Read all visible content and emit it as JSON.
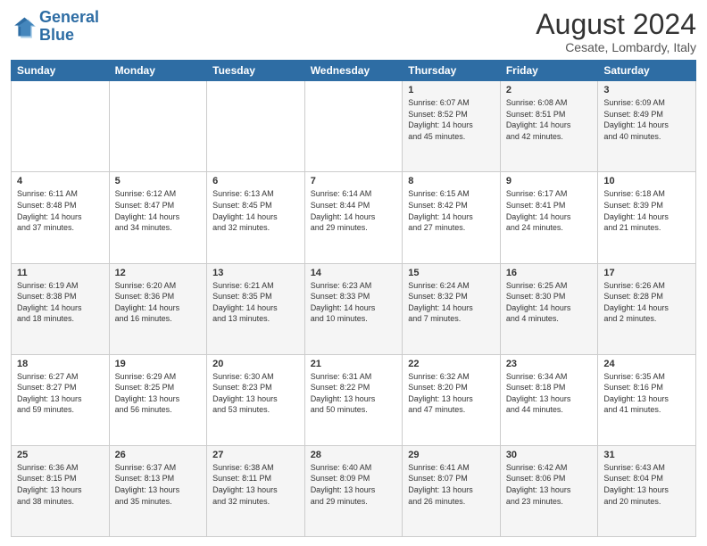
{
  "header": {
    "logo_line1": "General",
    "logo_line2": "Blue",
    "month_year": "August 2024",
    "location": "Cesate, Lombardy, Italy"
  },
  "days_of_week": [
    "Sunday",
    "Monday",
    "Tuesday",
    "Wednesday",
    "Thursday",
    "Friday",
    "Saturday"
  ],
  "weeks": [
    [
      {
        "day": "",
        "info": ""
      },
      {
        "day": "",
        "info": ""
      },
      {
        "day": "",
        "info": ""
      },
      {
        "day": "",
        "info": ""
      },
      {
        "day": "1",
        "info": "Sunrise: 6:07 AM\nSunset: 8:52 PM\nDaylight: 14 hours\nand 45 minutes."
      },
      {
        "day": "2",
        "info": "Sunrise: 6:08 AM\nSunset: 8:51 PM\nDaylight: 14 hours\nand 42 minutes."
      },
      {
        "day": "3",
        "info": "Sunrise: 6:09 AM\nSunset: 8:49 PM\nDaylight: 14 hours\nand 40 minutes."
      }
    ],
    [
      {
        "day": "4",
        "info": "Sunrise: 6:11 AM\nSunset: 8:48 PM\nDaylight: 14 hours\nand 37 minutes."
      },
      {
        "day": "5",
        "info": "Sunrise: 6:12 AM\nSunset: 8:47 PM\nDaylight: 14 hours\nand 34 minutes."
      },
      {
        "day": "6",
        "info": "Sunrise: 6:13 AM\nSunset: 8:45 PM\nDaylight: 14 hours\nand 32 minutes."
      },
      {
        "day": "7",
        "info": "Sunrise: 6:14 AM\nSunset: 8:44 PM\nDaylight: 14 hours\nand 29 minutes."
      },
      {
        "day": "8",
        "info": "Sunrise: 6:15 AM\nSunset: 8:42 PM\nDaylight: 14 hours\nand 27 minutes."
      },
      {
        "day": "9",
        "info": "Sunrise: 6:17 AM\nSunset: 8:41 PM\nDaylight: 14 hours\nand 24 minutes."
      },
      {
        "day": "10",
        "info": "Sunrise: 6:18 AM\nSunset: 8:39 PM\nDaylight: 14 hours\nand 21 minutes."
      }
    ],
    [
      {
        "day": "11",
        "info": "Sunrise: 6:19 AM\nSunset: 8:38 PM\nDaylight: 14 hours\nand 18 minutes."
      },
      {
        "day": "12",
        "info": "Sunrise: 6:20 AM\nSunset: 8:36 PM\nDaylight: 14 hours\nand 16 minutes."
      },
      {
        "day": "13",
        "info": "Sunrise: 6:21 AM\nSunset: 8:35 PM\nDaylight: 14 hours\nand 13 minutes."
      },
      {
        "day": "14",
        "info": "Sunrise: 6:23 AM\nSunset: 8:33 PM\nDaylight: 14 hours\nand 10 minutes."
      },
      {
        "day": "15",
        "info": "Sunrise: 6:24 AM\nSunset: 8:32 PM\nDaylight: 14 hours\nand 7 minutes."
      },
      {
        "day": "16",
        "info": "Sunrise: 6:25 AM\nSunset: 8:30 PM\nDaylight: 14 hours\nand 4 minutes."
      },
      {
        "day": "17",
        "info": "Sunrise: 6:26 AM\nSunset: 8:28 PM\nDaylight: 14 hours\nand 2 minutes."
      }
    ],
    [
      {
        "day": "18",
        "info": "Sunrise: 6:27 AM\nSunset: 8:27 PM\nDaylight: 13 hours\nand 59 minutes."
      },
      {
        "day": "19",
        "info": "Sunrise: 6:29 AM\nSunset: 8:25 PM\nDaylight: 13 hours\nand 56 minutes."
      },
      {
        "day": "20",
        "info": "Sunrise: 6:30 AM\nSunset: 8:23 PM\nDaylight: 13 hours\nand 53 minutes."
      },
      {
        "day": "21",
        "info": "Sunrise: 6:31 AM\nSunset: 8:22 PM\nDaylight: 13 hours\nand 50 minutes."
      },
      {
        "day": "22",
        "info": "Sunrise: 6:32 AM\nSunset: 8:20 PM\nDaylight: 13 hours\nand 47 minutes."
      },
      {
        "day": "23",
        "info": "Sunrise: 6:34 AM\nSunset: 8:18 PM\nDaylight: 13 hours\nand 44 minutes."
      },
      {
        "day": "24",
        "info": "Sunrise: 6:35 AM\nSunset: 8:16 PM\nDaylight: 13 hours\nand 41 minutes."
      }
    ],
    [
      {
        "day": "25",
        "info": "Sunrise: 6:36 AM\nSunset: 8:15 PM\nDaylight: 13 hours\nand 38 minutes."
      },
      {
        "day": "26",
        "info": "Sunrise: 6:37 AM\nSunset: 8:13 PM\nDaylight: 13 hours\nand 35 minutes."
      },
      {
        "day": "27",
        "info": "Sunrise: 6:38 AM\nSunset: 8:11 PM\nDaylight: 13 hours\nand 32 minutes."
      },
      {
        "day": "28",
        "info": "Sunrise: 6:40 AM\nSunset: 8:09 PM\nDaylight: 13 hours\nand 29 minutes."
      },
      {
        "day": "29",
        "info": "Sunrise: 6:41 AM\nSunset: 8:07 PM\nDaylight: 13 hours\nand 26 minutes."
      },
      {
        "day": "30",
        "info": "Sunrise: 6:42 AM\nSunset: 8:06 PM\nDaylight: 13 hours\nand 23 minutes."
      },
      {
        "day": "31",
        "info": "Sunrise: 6:43 AM\nSunset: 8:04 PM\nDaylight: 13 hours\nand 20 minutes."
      }
    ]
  ]
}
